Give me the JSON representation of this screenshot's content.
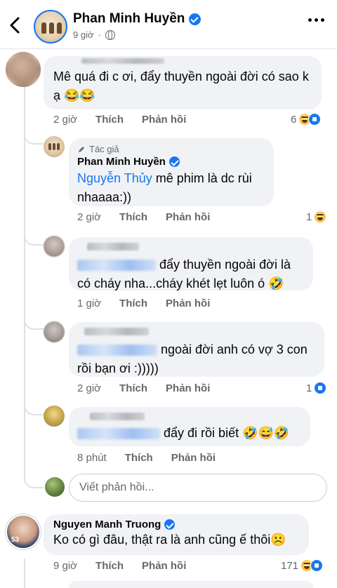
{
  "header": {
    "page_name": "Phan Minh Huyền",
    "time": "9 giờ",
    "separator": "·"
  },
  "comments": [
    {
      "id": "c1",
      "author_blurred": "Nguyen Thuy",
      "text": "Mê quá đi c ơi, đẩy thuyền ngoài đời có sao k ạ 😂😂",
      "time": "2 giờ",
      "like": "Thích",
      "reply": "Phản hồi",
      "reaction_count": "6"
    },
    {
      "id": "r1",
      "author_tag": "Tác giả",
      "author": "Phan Minh Huyền",
      "mention": "Nguyễn Thủy",
      "text": " mê phim là dc rùi nhaaaa:))",
      "time": "2 giờ",
      "like": "Thích",
      "reply": "Phản hồi",
      "reaction_count": "1"
    },
    {
      "id": "r2",
      "text": "đẩy thuyền ngoài đời là có cháy nha...cháy khét lẹt luôn ó 🤣",
      "time": "1 giờ",
      "like": "Thích",
      "reply": "Phản hồi"
    },
    {
      "id": "r3",
      "text": "ngoài đời anh có vợ 3 con rồi bạn ơi :)))))",
      "time": "2 giờ",
      "like": "Thích",
      "reply": "Phản hồi",
      "reaction_count": "1"
    },
    {
      "id": "r4",
      "text": "đẩy đi rồi biết 🤣😅🤣",
      "time": "8 phút",
      "like": "Thích",
      "reply": "Phản hồi"
    },
    {
      "id": "c2",
      "author": "Nguyen Manh Truong",
      "text": "Ko có gì đâu, thật ra là anh cũng ế thôi☹️",
      "time": "9 giờ",
      "like": "Thích",
      "reply": "Phản hồi",
      "reaction_count": "171"
    }
  ],
  "reply_box": {
    "placeholder": "Viết phản hồi..."
  },
  "colors": {
    "verified": "#1877f2",
    "mention": "#1877f2",
    "bubble": "#f0f2f5",
    "meta_text": "#65676b"
  }
}
